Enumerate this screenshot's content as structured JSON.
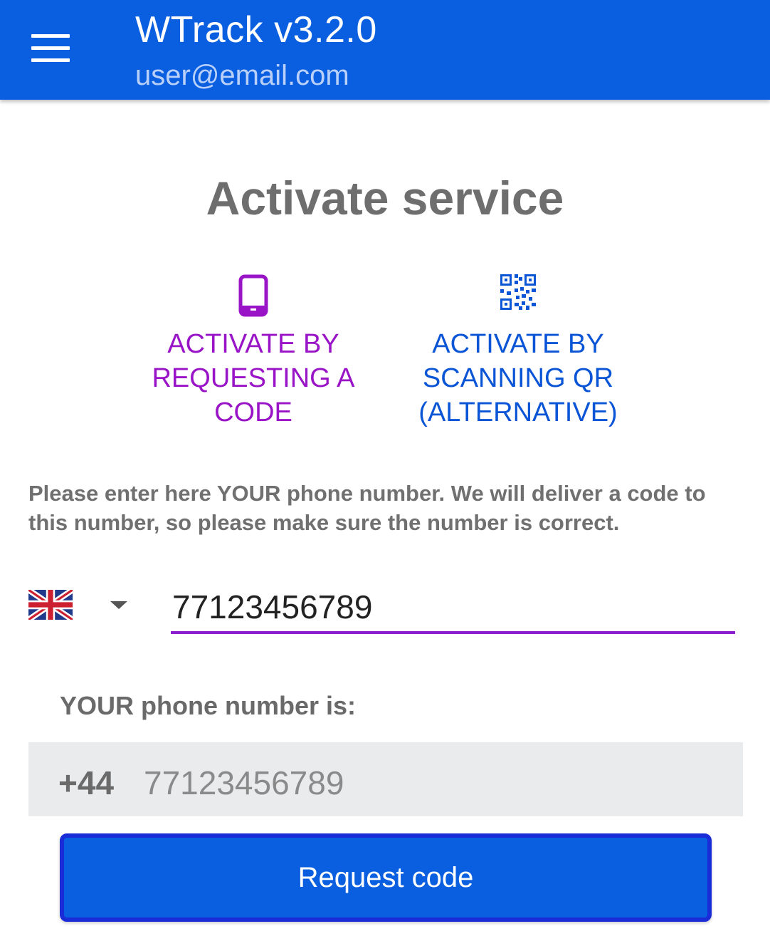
{
  "appbar": {
    "title": "WTrack v3.2.0",
    "subtitle": "user@email.com",
    "menu_icon": "hamburger-menu-icon",
    "color": "#0a5fe0"
  },
  "page": {
    "title": "Activate service"
  },
  "options": {
    "request_code": {
      "icon": "smartphone-icon",
      "label": "ACTIVATE BY REQUESTING A CODE",
      "color": "#9a14c7"
    },
    "scan_qr": {
      "icon": "qr-code-icon",
      "label": "ACTIVATE BY SCANNING QR (ALTERNATIVE)",
      "color": "#0a55d6"
    }
  },
  "instructions": "Please enter here YOUR phone number. We will deliver a code to this number, so please make sure the number is correct.",
  "phone": {
    "country_flag": "uk-flag-icon",
    "input_value": "77123456789"
  },
  "result": {
    "label": "YOUR phone number is:",
    "prefix": "+44",
    "number": "77123456789"
  },
  "button": {
    "label": "Request code"
  }
}
